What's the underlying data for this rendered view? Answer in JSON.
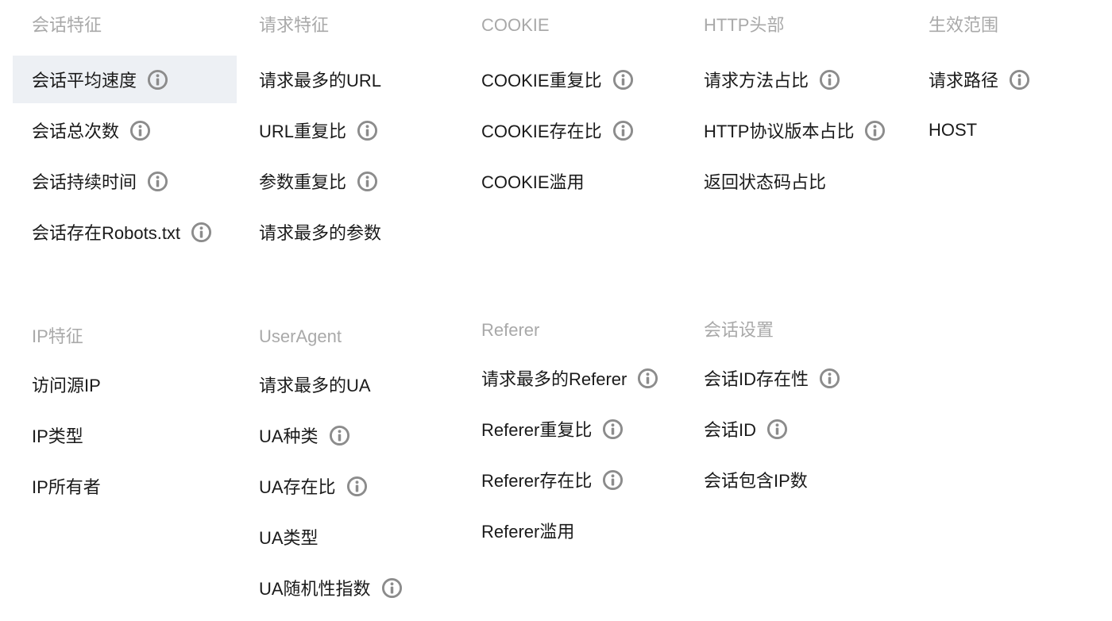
{
  "groups": [
    {
      "title": "会话特征",
      "items": [
        {
          "label": "会话平均速度",
          "info": true,
          "selected": true
        },
        {
          "label": "会话总次数",
          "info": true
        },
        {
          "label": "会话持续时间",
          "info": true
        },
        {
          "label": "会话存在Robots.txt",
          "info": true
        }
      ]
    },
    {
      "title": "请求特征",
      "items": [
        {
          "label": "请求最多的URL",
          "info": false
        },
        {
          "label": "URL重复比",
          "info": true
        },
        {
          "label": "参数重复比",
          "info": true
        },
        {
          "label": "请求最多的参数",
          "info": false
        }
      ]
    },
    {
      "title": "COOKIE",
      "items": [
        {
          "label": "COOKIE重复比",
          "info": true
        },
        {
          "label": "COOKIE存在比",
          "info": true
        },
        {
          "label": "COOKIE滥用",
          "info": false
        }
      ]
    },
    {
      "title": "HTTP头部",
      "items": [
        {
          "label": "请求方法占比",
          "info": true
        },
        {
          "label": "HTTP协议版本占比",
          "info": true
        },
        {
          "label": "返回状态码占比",
          "info": false
        }
      ]
    },
    {
      "title": "生效范围",
      "items": [
        {
          "label": "请求路径",
          "info": true
        },
        {
          "label": "HOST",
          "info": false
        }
      ]
    },
    {
      "title": "IP特征",
      "items": [
        {
          "label": "访问源IP",
          "info": false
        },
        {
          "label": "IP类型",
          "info": false
        },
        {
          "label": "IP所有者",
          "info": false
        }
      ]
    },
    {
      "title": "UserAgent",
      "items": [
        {
          "label": "请求最多的UA",
          "info": false
        },
        {
          "label": "UA种类",
          "info": true
        },
        {
          "label": "UA存在比",
          "info": true
        },
        {
          "label": "UA类型",
          "info": false
        },
        {
          "label": "UA随机性指数",
          "info": true
        }
      ]
    },
    {
      "title": "Referer",
      "items": [
        {
          "label": "请求最多的Referer",
          "info": true
        },
        {
          "label": "Referer重复比",
          "info": true
        },
        {
          "label": "Referer存在比",
          "info": true
        },
        {
          "label": "Referer滥用",
          "info": false
        }
      ]
    },
    {
      "title": "会话设置",
      "items": [
        {
          "label": "会话ID存在性",
          "info": true
        },
        {
          "label": "会话ID",
          "info": true
        },
        {
          "label": "会话包含IP数",
          "info": false
        }
      ]
    }
  ],
  "icons": {
    "info": "info-circle-icon"
  },
  "colors": {
    "title": "#a9a9a9",
    "text": "#1a1a1a",
    "icon": "#8c8c8c",
    "selected_bg": "#edf0f4"
  }
}
